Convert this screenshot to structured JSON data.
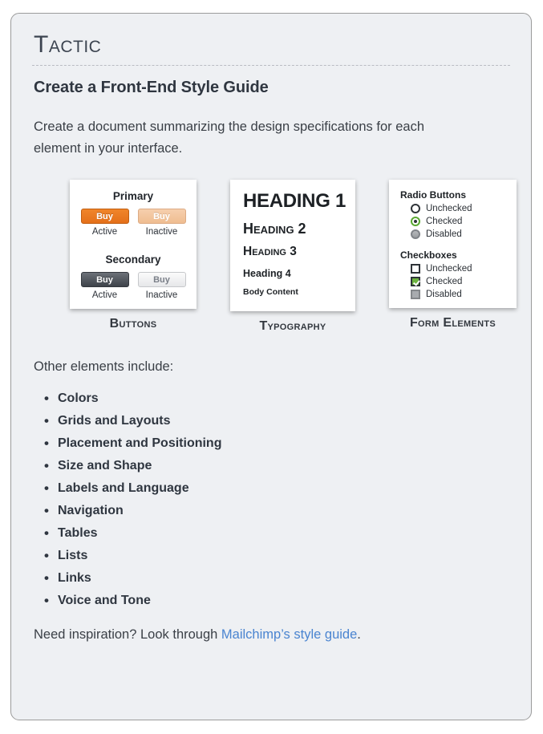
{
  "header": {
    "kicker": "Tactic",
    "title": "Create a Front-End Style Guide",
    "intro": "Create a document summarizing the design specifications for each element in your interface."
  },
  "cards": {
    "buttons": {
      "caption": "Buttons",
      "groups": [
        {
          "title": "Primary",
          "buttons": [
            {
              "label": "Buy",
              "state": "Active"
            },
            {
              "label": "Buy",
              "state": "Inactive"
            }
          ]
        },
        {
          "title": "Secondary",
          "buttons": [
            {
              "label": "Buy",
              "state": "Active"
            },
            {
              "label": "Buy",
              "state": "Inactive"
            }
          ]
        }
      ]
    },
    "typography": {
      "caption": "Typography",
      "lines": [
        "HEADING 1",
        "Heading 2",
        "Heading 3",
        "Heading 4",
        "Body Content"
      ]
    },
    "form_elements": {
      "caption": "Form Elements",
      "radio_group": {
        "title": "Radio Buttons",
        "options": [
          "Unchecked",
          "Checked",
          "Disabled"
        ]
      },
      "checkbox_group": {
        "title": "Checkboxes",
        "options": [
          "Unchecked",
          "Checked",
          "Disabled"
        ]
      }
    }
  },
  "other": {
    "heading": "Other elements include:",
    "items": [
      "Colors",
      "Grids and Layouts",
      "Placement and Positioning",
      "Size and Shape",
      "Labels and Language",
      "Navigation",
      "Tables",
      "Lists",
      "Links",
      "Voice and Tone"
    ]
  },
  "footer": {
    "prefix": "Need inspiration? Look through ",
    "link_text": "Mailchimp’s style guide",
    "suffix": "."
  },
  "colors": {
    "page_background": "#ffffff",
    "card_background": "#eef0f3",
    "card_border": "#9b9b9b",
    "text_primary": "#2f3640",
    "text_body": "#3a3f46",
    "primary_button": "#e4701a",
    "primary_button_inactive": "#efbd91",
    "secondary_button": "#3e434a",
    "accent_green": "#6cb33f",
    "link_blue": "#4a84d0"
  }
}
